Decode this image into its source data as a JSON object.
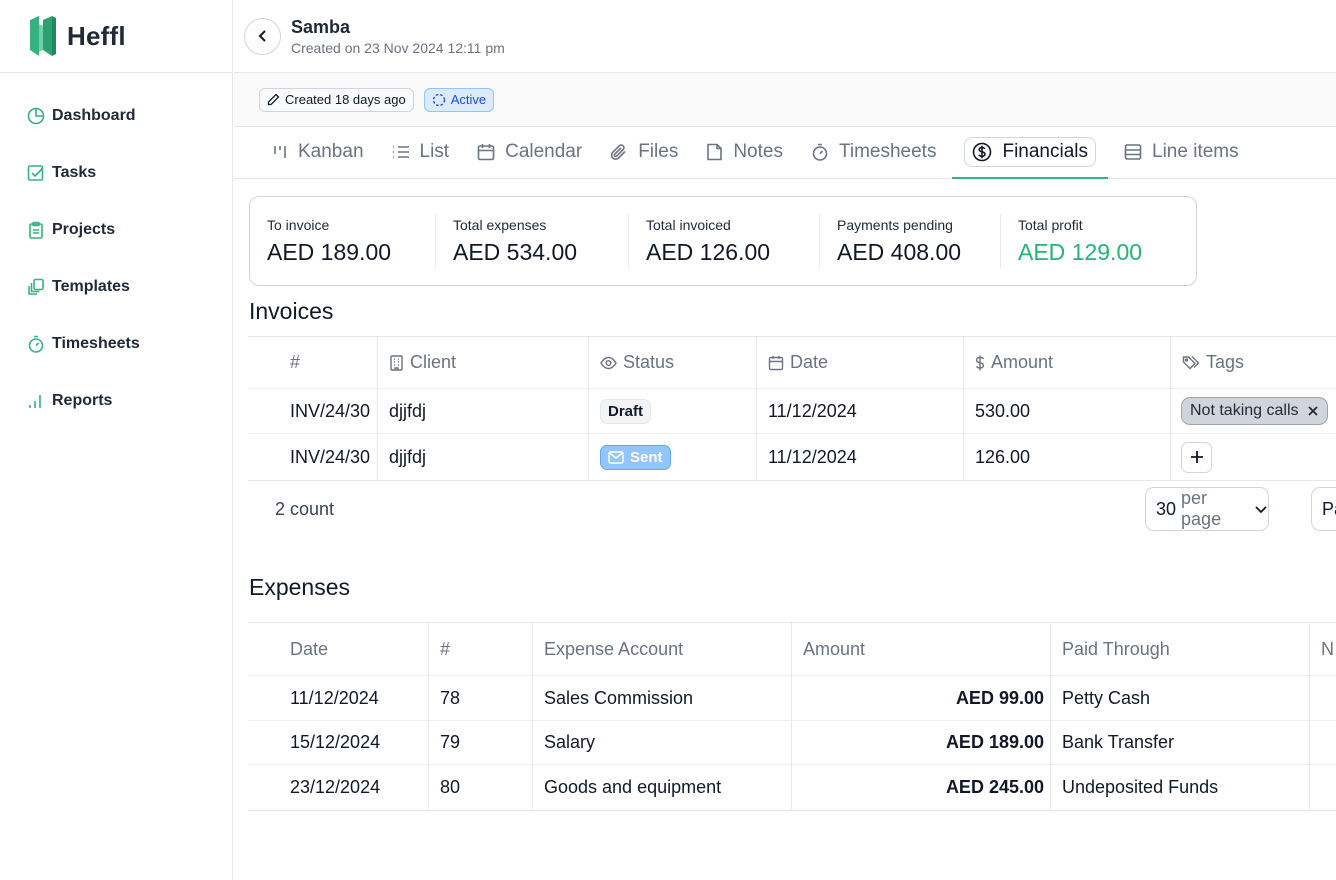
{
  "brand": {
    "name": "Heffl",
    "accent": "#34b37e"
  },
  "sidebar": {
    "items": [
      {
        "label": "Dashboard",
        "icon": "pie-chart-icon"
      },
      {
        "label": "Tasks",
        "icon": "check-square-icon"
      },
      {
        "label": "Projects",
        "icon": "clipboard-icon"
      },
      {
        "label": "Templates",
        "icon": "copy-icon"
      },
      {
        "label": "Timesheets",
        "icon": "timer-icon"
      },
      {
        "label": "Reports",
        "icon": "bar-chart-icon"
      }
    ]
  },
  "header": {
    "title": "Samba",
    "subtitle": "Created on 23 Nov 2024 12:11 pm"
  },
  "meta": {
    "created": "Created 18 days ago",
    "status": "Active"
  },
  "tabs": [
    {
      "label": "Kanban",
      "icon": "kanban-icon"
    },
    {
      "label": "List",
      "icon": "list-icon"
    },
    {
      "label": "Calendar",
      "icon": "calendar-icon"
    },
    {
      "label": "Files",
      "icon": "paperclip-icon"
    },
    {
      "label": "Notes",
      "icon": "note-icon"
    },
    {
      "label": "Timesheets",
      "icon": "timer-icon"
    },
    {
      "label": "Financials",
      "icon": "dollar-circle-icon",
      "active": true
    },
    {
      "label": "Line items",
      "icon": "line-items-icon"
    }
  ],
  "summary": [
    {
      "label": "To invoice",
      "value": "AED 189.00"
    },
    {
      "label": "Total expenses",
      "value": "AED 534.00"
    },
    {
      "label": "Total invoiced",
      "value": "AED 126.00"
    },
    {
      "label": "Payments pending",
      "value": "AED 408.00"
    },
    {
      "label": "Total profit",
      "value": "AED 129.00",
      "color": "#22b573"
    }
  ],
  "invoices": {
    "title": "Invoices",
    "columns": [
      "#",
      "Client",
      "Status",
      "Date",
      "Amount",
      "Tags"
    ],
    "rows": [
      {
        "number": "INV/24/30",
        "client": "djjfdj",
        "status": "Draft",
        "date": "11/12/2024",
        "amount": "530.00",
        "tag": "Not taking calls"
      },
      {
        "number": "INV/24/30",
        "client": "djjfdj",
        "status": "Sent",
        "date": "11/12/2024",
        "amount": "126.00",
        "tag": ""
      }
    ],
    "count": "2 count",
    "per_page_num": "30",
    "per_page_text": "per page",
    "page_label": "Pa"
  },
  "expenses": {
    "title": "Expenses",
    "columns": [
      "Date",
      "#",
      "Expense Account",
      "Amount",
      "Paid Through",
      "N"
    ],
    "rows": [
      {
        "date": "11/12/2024",
        "number": "78",
        "account": "Sales Commission",
        "amount": "AED 99.00",
        "paid_through": "Petty Cash"
      },
      {
        "date": "15/12/2024",
        "number": "79",
        "account": "Salary",
        "amount": "AED 189.00",
        "paid_through": "Bank Transfer"
      },
      {
        "date": "23/12/2024",
        "number": "80",
        "account": "Goods and equipment",
        "amount": "AED 245.00",
        "paid_through": "Undeposited Funds"
      }
    ]
  }
}
